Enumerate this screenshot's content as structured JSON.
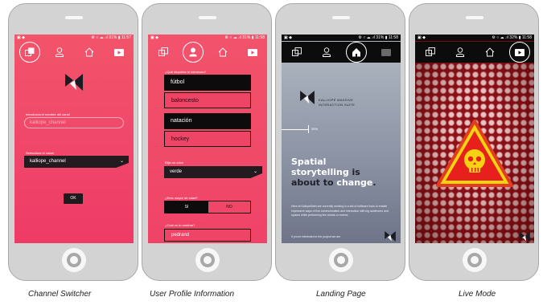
{
  "status_bar": {
    "screen1": "⚙ ○ ☁ .ıl 31% ▮ 11:57",
    "screen2": "⚙ ○ ☁ .ıl 31% ▮ 11:58",
    "screen3": "⚙ ○ ☁ .ıl 31% ▮ 11:58",
    "screen4": "⚙ ○ ☁ .ıl 32% ▮ 11:58"
  },
  "nav_icons": [
    "channel-switch-icon",
    "user-icon",
    "home-icon",
    "live-icon"
  ],
  "colors": {
    "pink": "#f0456a",
    "dark": "#0e0b0d",
    "landing_gray": "#9aa2b1",
    "live_red": "#8d1116",
    "warning_yellow": "#f5d312"
  },
  "channel_switcher": {
    "input_label": "Introduzca el nombre del canal",
    "input_placeholder": "kalliope_channel",
    "select_label": "Seleccione el canal",
    "select_value": "kalliope_channel",
    "ok_label": "OK"
  },
  "user_profile": {
    "sports_label": "¿Qué deportes te interesan?",
    "sports": [
      {
        "label": "fútbol",
        "selected": true
      },
      {
        "label": "baloncesto",
        "selected": false
      },
      {
        "label": "natación",
        "selected": true
      },
      {
        "label": "hockey",
        "selected": false
      }
    ],
    "color_label": "Elije un color",
    "color_value": "verde",
    "age_label": "¿Eres mayor de edad?",
    "age_yes": "SI",
    "age_no": "NO",
    "name_label": "¿Cuál es tu nombre?",
    "name_value": "pedrand"
  },
  "landing": {
    "brand_line1": "KALLIOPÉ MASSIVE",
    "brand_line2": "INTERACTION SUITE",
    "progress_text": "35%",
    "headline_1": "Spatial",
    "headline_2": "storytelling",
    "headline_3": " is",
    "headline_4": "about to ",
    "headline_5": "change",
    "headline_6": ".",
    "body": "Here at KaliopeMain are currently working in a set of software tools to enable impressive ways of live communication and interaction with big audiences and spaces while performing live shows or events.",
    "body2": "If you're interested in the project we are"
  },
  "captions": [
    "Channel Switcher",
    "User Profile Information",
    "Landing Page",
    "Live Mode"
  ]
}
